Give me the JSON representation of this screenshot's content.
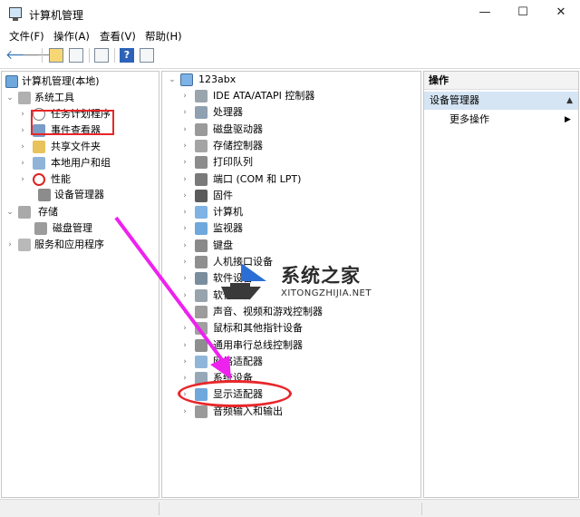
{
  "window": {
    "title": "计算机管理",
    "minimize_glyph": "—",
    "maximize_glyph": "☐",
    "close_glyph": "✕"
  },
  "menubar": {
    "items": [
      "文件(F)",
      "操作(A)",
      "查看(V)",
      "帮助(H)"
    ]
  },
  "toolbar": {
    "icons": [
      "back-arrow-icon",
      "forward-arrow-icon",
      "up-folder-icon",
      "show-hide-tree-icon",
      "properties-icon",
      "help-icon",
      "show-hide-action-pane-icon"
    ],
    "help_label": "?"
  },
  "tree": {
    "root": "计算机管理(本地)",
    "system_tools": "系统工具",
    "task_scheduler": "任务计划程序",
    "event_viewer": "事件查看器",
    "shared_folders": "共享文件夹",
    "local_users": "本地用户和组",
    "performance": "性能",
    "device_manager": "设备管理器",
    "storage": "存储",
    "disk_management": "磁盘管理",
    "services": "服务和应用程序"
  },
  "devices": {
    "computer_name": "123abx",
    "items": [
      "IDE ATA/ATAPI 控制器",
      "处理器",
      "磁盘驱动器",
      "存储控制器",
      "打印队列",
      "端口 (COM 和 LPT)",
      "固件",
      "计算机",
      "监视器",
      "键盘",
      "人机接口设备",
      "软件设备",
      "软件组件",
      "声音、视频和游戏控制器",
      "鼠标和其他指针设备",
      "通用串行总线控制器",
      "网络适配器",
      "系统设备",
      "显示适配器",
      "音频输入和输出"
    ]
  },
  "actions": {
    "header": "操作",
    "selected": "设备管理器",
    "more": "更多操作"
  },
  "watermark": {
    "title": "系统之家",
    "url": "XITONGZHIJIA.NET"
  },
  "colors": {
    "highlight": "#e8262a",
    "arrow": "#ee22ee",
    "selection": "#d5e5f4"
  }
}
